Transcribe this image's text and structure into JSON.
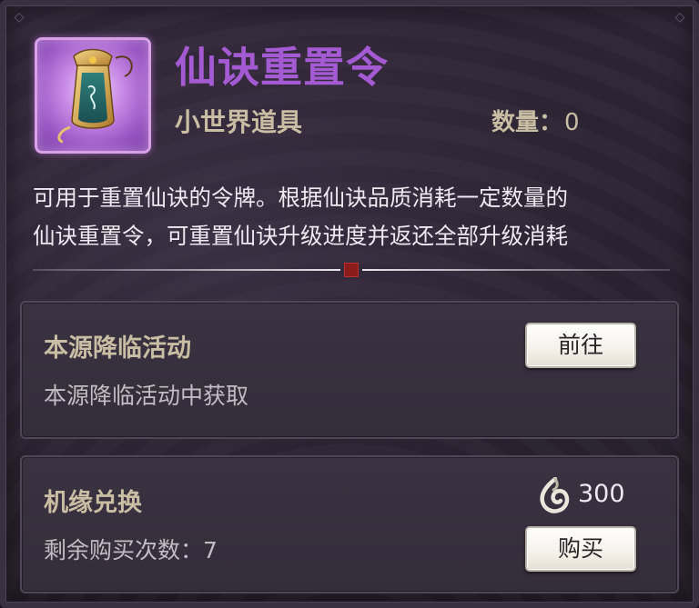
{
  "item": {
    "name": "仙诀重置令",
    "type": "小世界道具",
    "quantity_label": "数量：",
    "quantity_value": "0",
    "icon": "token-tablet-icon",
    "name_color": "#a35ad2"
  },
  "description": {
    "line1": "可用于重置仙诀的令牌。根据仙诀品质消耗一定数量的",
    "line2": "仙诀重置令，可重置仙诀升级进度并返还全部升级消耗"
  },
  "sources": [
    {
      "title": "本源降临活动",
      "subtitle": "本源降临活动中获取",
      "button_label": "前往"
    },
    {
      "title": "机缘兑换",
      "subtitle": "剩余购买次数：7",
      "button_label": "购买",
      "price_value": "300",
      "price_icon": "jade-coin-icon"
    }
  ]
}
